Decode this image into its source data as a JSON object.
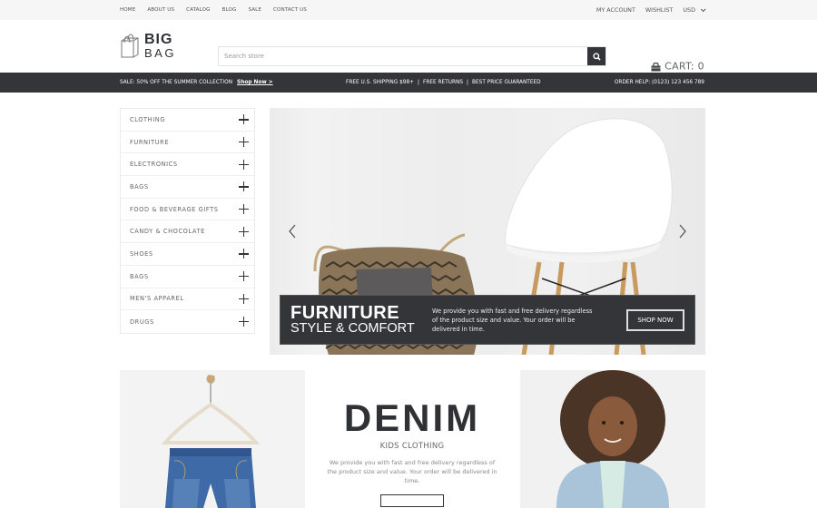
{
  "topbar": {
    "nav": [
      "HOME",
      "ABOUT US",
      "CATALOG",
      "BLOG",
      "SALE",
      "CONTACT US"
    ],
    "my_account": "MY ACCOUNT",
    "wishlist": "WISHLIST",
    "currency": "USD"
  },
  "header": {
    "logo_big": "BIG",
    "logo_small": "BAG",
    "search_placeholder": "Search store",
    "cart_label": "CART: 0"
  },
  "promo": {
    "sale_text": "SALE: 50% OFF THE SUMMER COLLECTION",
    "shop_now_link": "Shop Now >",
    "shipping": "FREE U.S. SHIPPING $98+",
    "returns": "FREE RETURNS",
    "price": "BEST PRICE GUARANTEED",
    "separator": "|",
    "order_help": "ORDER HELP: (0123) 123 456 789"
  },
  "categories": [
    {
      "label": "CLOTHING"
    },
    {
      "label": "FURNITURE"
    },
    {
      "label": "ELECTRONICS"
    },
    {
      "label": "BAGS"
    },
    {
      "label": "FOOD & BEVERAGE GIFTS"
    },
    {
      "label": "CANDY & CHOCOLATE"
    },
    {
      "label": "SHOES"
    },
    {
      "label": "BAGS"
    },
    {
      "label": "MEN'S APPAREL"
    },
    {
      "label": "DRUGS"
    }
  ],
  "hero": {
    "title": "FURNITURE",
    "subtitle": "STYLE & COMFORT",
    "description": "We provide you with fast and free delivery regardless of the product size and value. Your order will be delivered in time.",
    "button": "SHOP NOW"
  },
  "denim": {
    "title": "DENIM",
    "subtitle": "KIDS CLOTHING",
    "description": "We provide you with fast and free delivery regardless of the product size and value. Your order will be delivered in time."
  },
  "colors": {
    "dark": "#333538",
    "topbar": "#f6f6f6"
  }
}
